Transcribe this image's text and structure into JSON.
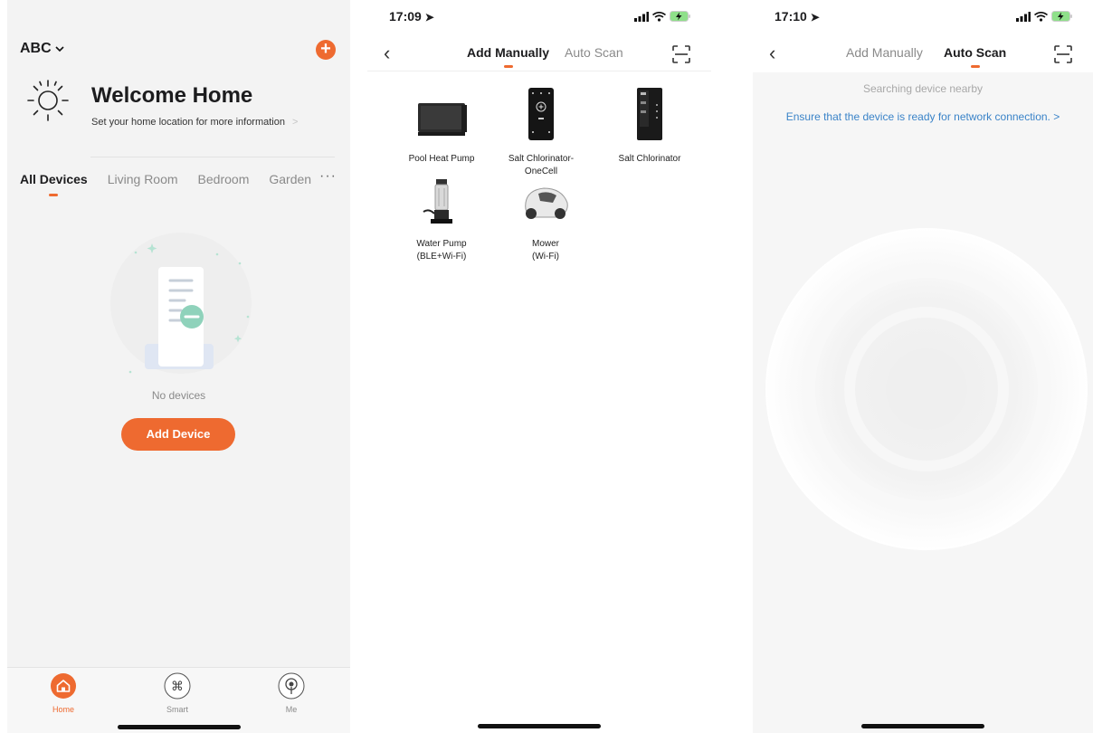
{
  "colors": {
    "accent": "#ee6a30",
    "link": "#3a83c8"
  },
  "home": {
    "home_name": "ABC",
    "welcome_title": "Welcome Home",
    "location_prompt": "Set your home location for more information",
    "tabs": [
      "All Devices",
      "Living Room",
      "Bedroom",
      "Garden"
    ],
    "more_icon": "more-dots-icon",
    "empty_text": "No devices",
    "add_device_label": "Add Device",
    "tabbar": [
      {
        "label": "Home",
        "icon": "home-icon"
      },
      {
        "label": "Smart",
        "icon": "command-icon"
      },
      {
        "label": "Me",
        "icon": "profile-icon"
      }
    ]
  },
  "manual": {
    "time": "17:09",
    "tab_manual": "Add Manually",
    "tab_scan": "Auto Scan",
    "devices": [
      {
        "name_line1": "Pool Heat Pump",
        "name_line2": ""
      },
      {
        "name_line1": "Salt Chlorinator-",
        "name_line2": "OneCell"
      },
      {
        "name_line1": "Salt Chlorinator",
        "name_line2": ""
      },
      {
        "name_line1": "Water Pump",
        "name_line2": "(BLE+Wi-Fi)"
      },
      {
        "name_line1": "Mower",
        "name_line2": "(Wi-Fi)"
      }
    ]
  },
  "scan": {
    "time": "17:10",
    "tab_manual": "Add Manually",
    "tab_scan": "Auto Scan",
    "searching_text": "Searching device nearby",
    "ensure_text": "Ensure that the device is ready for network connection. >"
  }
}
